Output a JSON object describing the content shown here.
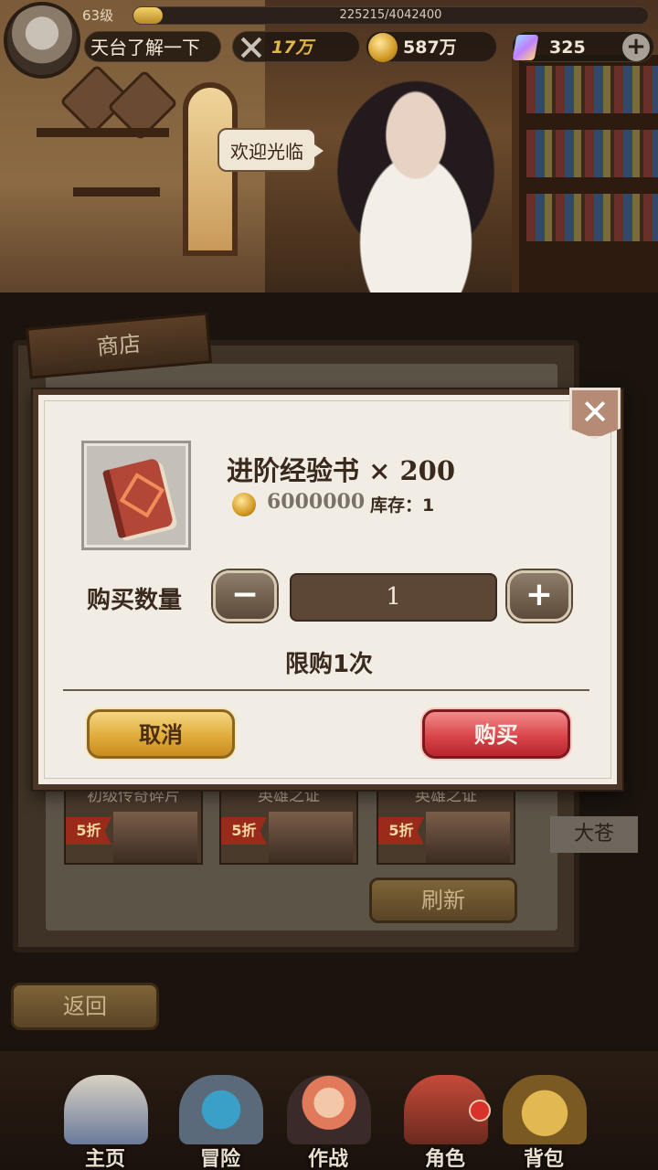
{
  "player": {
    "level": "63级",
    "exp_text": "225215/4042400",
    "exp_fraction": 0.056,
    "name": "天台了解一下",
    "power": "17万",
    "gold": "587万",
    "gems": "325",
    "add_gem_label": "+"
  },
  "scene": {
    "npc_speech": "欢迎光临"
  },
  "shop": {
    "title": "商店",
    "cards": [
      {
        "title": "初级传奇碎片",
        "discount": "5折"
      },
      {
        "title": "英雄之证",
        "discount": "5折"
      },
      {
        "title": "英雄之证",
        "discount": "5折"
      }
    ],
    "side_label": "大苍",
    "refresh_label": "刷新",
    "back_label": "返回"
  },
  "dialog": {
    "close_label": "✕",
    "item_name": "进阶经验书 × 200",
    "price": "6000000",
    "stock": "库存：1",
    "qty_label": "购买数量",
    "qty_minus": "−",
    "qty_value": "1",
    "qty_plus": "+",
    "limit_text": "限购1次",
    "cancel_label": "取消",
    "buy_label": "购买"
  },
  "nav": {
    "items": [
      {
        "label": "主页",
        "icon": "castle-icon"
      },
      {
        "label": "冒险",
        "icon": "portal-icon"
      },
      {
        "label": "作战",
        "icon": "battle-icon"
      },
      {
        "label": "角色",
        "icon": "character-icon"
      },
      {
        "label": "背包",
        "icon": "backpack-icon"
      }
    ],
    "badge_color": "#d9322a"
  },
  "colors": {
    "buy_button": "#d9464a",
    "cancel_button": "#e0ac3a",
    "dialog_bg": "#f2ede4"
  }
}
